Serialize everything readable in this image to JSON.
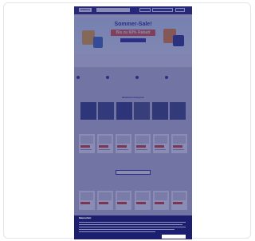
{
  "header": {
    "logo": "WIRDUS",
    "search_placeholder": "",
    "login_label": "",
    "register_label": "",
    "cart_label": ""
  },
  "hero": {
    "title": "Sommer-Sale!",
    "badge": "Bis zu 60% Rabatt",
    "cta": ""
  },
  "usps": [
    "",
    "",
    "",
    ""
  ],
  "sections": {
    "categories_title": "Beliebteste Kategorien",
    "products_title": "",
    "more_button": "",
    "second_products_title": ""
  },
  "categories": [
    "",
    "",
    "",
    "",
    "",
    ""
  ],
  "cookie": {
    "title": "Datenschutz",
    "settings_link": "",
    "reject_label": "",
    "accept_label": ""
  },
  "colors": {
    "brand": "#20257a",
    "accent": "#e8553a",
    "overlay": "#1b1f6e"
  }
}
